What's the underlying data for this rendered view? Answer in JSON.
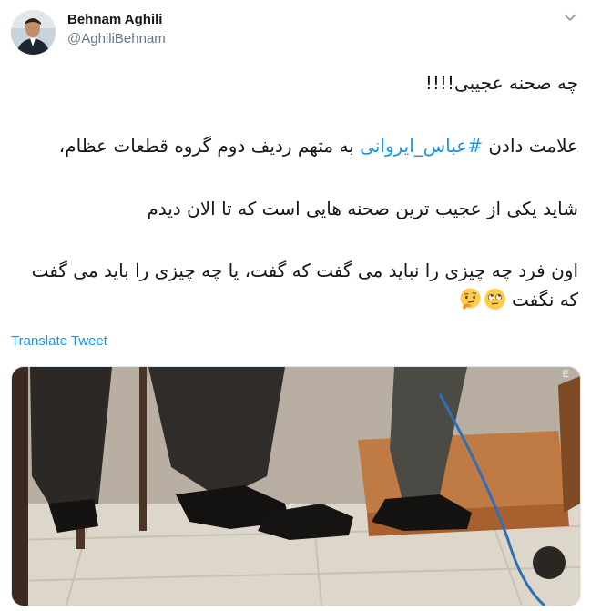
{
  "author": {
    "name": "Behnam Aghili",
    "handle": "@AghiliBehnam"
  },
  "tweet": {
    "line1": "چه صحنه عجیبی!!!!",
    "line2_before": "علامت دادن ",
    "hashtag": "#عباس_ایروانی",
    "line2_after": " به متهم ردیف دوم گروه قطعات عظام،",
    "line3": "شاید یکی از عجیب ترین صحنه هایی است که تا الان دیدم",
    "line4": "اون فرد چه چیزی را نباید می گفت که گفت، یا چه چیزی را باید می گفت",
    "line5": "که نگفت",
    "emojis": [
      "face-with-rolling-eyes-emoji",
      "thinking-face-emoji"
    ]
  },
  "translate_label": "Translate Tweet",
  "media": {
    "watermark": "E",
    "icon": "photo-two-people-feet-signal"
  },
  "colors": {
    "link": "#1b95e0",
    "secondary_text": "#657786",
    "primary_text": "#14171a"
  }
}
